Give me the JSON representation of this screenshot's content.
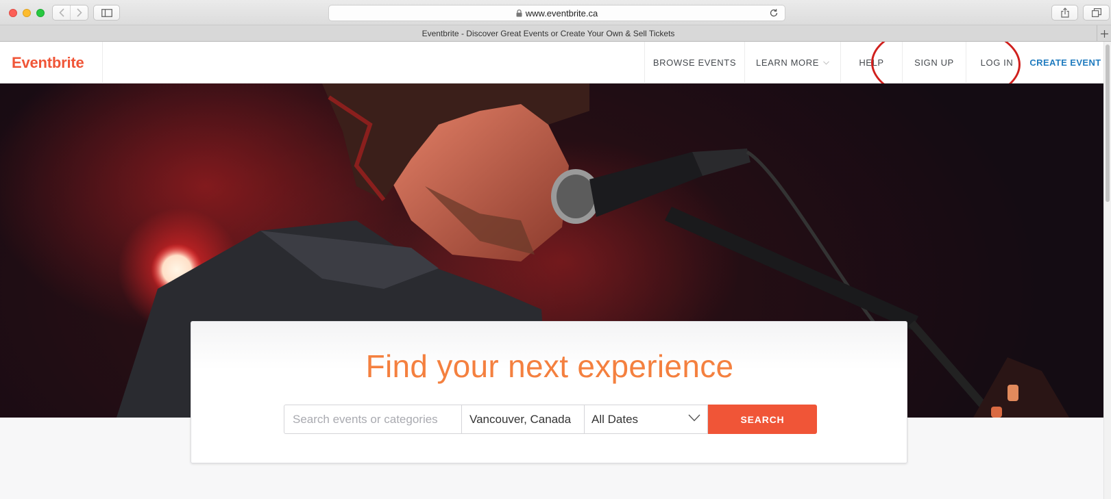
{
  "browser": {
    "url": "www.eventbrite.ca",
    "tab_title": "Eventbrite - Discover Great Events or Create Your Own & Sell Tickets",
    "icons": [
      "back-icon",
      "forward-icon",
      "sidebar-icon",
      "lock-icon",
      "reload-icon",
      "share-icon",
      "tabs-icon",
      "new-tab-icon"
    ]
  },
  "header": {
    "logo": "Eventbrite",
    "nav": {
      "browse": "BROWSE EVENTS",
      "learn": "LEARN MORE",
      "help": "HELP",
      "signup": "SIGN UP",
      "login": "LOG IN",
      "create": "CREATE EVENT"
    }
  },
  "hero": {
    "headline": "Find your next experience"
  },
  "search": {
    "placeholder": "Search events or categories",
    "location": "Vancouver, Canada",
    "date": "All Dates",
    "button": "SEARCH"
  },
  "colors": {
    "brand": "#f05537",
    "headline": "#f4803f",
    "create_link": "#1f7bbf",
    "annotation": "#d0201d"
  }
}
